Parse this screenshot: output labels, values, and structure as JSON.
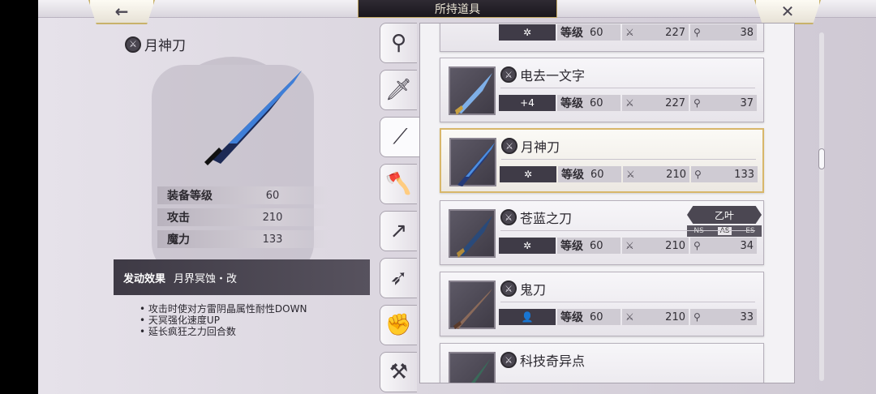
{
  "header": {
    "title": "所持道具",
    "back_icon": "←",
    "close_icon": "✕"
  },
  "detail": {
    "name": "月神刀",
    "stats": [
      {
        "label": "装备等级",
        "value": "60"
      },
      {
        "label": "攻击",
        "value": "210"
      },
      {
        "label": "魔力",
        "value": "133"
      }
    ],
    "effect_title": "发动效果",
    "effect_name": "月界冥蚀・改",
    "effects": [
      "攻击时使对方雷阴晶属性耐性DOWN",
      "天冥强化速度UP",
      "延长疯狂之力回合数"
    ]
  },
  "tabs": [
    {
      "name": "staff"
    },
    {
      "name": "sword"
    },
    {
      "name": "katana"
    },
    {
      "name": "axe"
    },
    {
      "name": "spear"
    },
    {
      "name": "bow"
    },
    {
      "name": "fist"
    },
    {
      "name": "hammer"
    }
  ],
  "items": [
    {
      "name": "",
      "badge": "✲",
      "level_label": "等级",
      "level": "60",
      "atk": "227",
      "mag": "38"
    },
    {
      "name": "电去一文字",
      "badge": "+4",
      "level_label": "等级",
      "level": "60",
      "atk": "227",
      "mag": "37"
    },
    {
      "name": "月神刀",
      "badge": "✲",
      "level_label": "等级",
      "level": "60",
      "atk": "210",
      "mag": "133"
    },
    {
      "name": "苍蓝之刀",
      "badge": "✲",
      "level_label": "等级",
      "level": "60",
      "atk": "210",
      "mag": "34",
      "owner": "乙叶",
      "modes": [
        "NS",
        "AS",
        "ES"
      ]
    },
    {
      "name": "鬼刀",
      "badge": "👤",
      "level_label": "等级",
      "level": "60",
      "atk": "210",
      "mag": "33"
    },
    {
      "name": "科技奇异点",
      "badge": "",
      "level_label": "",
      "level": "",
      "atk": "",
      "mag": ""
    }
  ],
  "colors": {
    "accent": "#d8b76a",
    "dark": "#3f3b47"
  }
}
